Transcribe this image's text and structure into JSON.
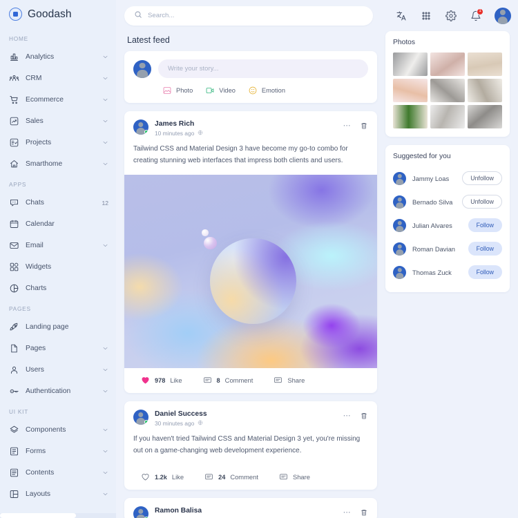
{
  "brand": {
    "name": "Goodash",
    "logo_icon": "goodash-logo"
  },
  "sidebar": {
    "groups": [
      {
        "label": "HOME",
        "items": [
          {
            "label": "Analytics",
            "icon": "bar-chart-icon",
            "chevron": true
          },
          {
            "label": "CRM",
            "icon": "people-group-icon",
            "chevron": true
          },
          {
            "label": "Ecommerce",
            "icon": "shopping-cart-icon",
            "chevron": true
          },
          {
            "label": "Sales",
            "icon": "trend-up-square-icon",
            "chevron": true
          },
          {
            "label": "Projects",
            "icon": "task-list-icon",
            "chevron": true
          },
          {
            "label": "Smarthome",
            "icon": "home-smart-icon",
            "chevron": true
          }
        ]
      },
      {
        "label": "APPS",
        "items": [
          {
            "label": "Chats",
            "icon": "chat-bubble-icon",
            "badge": "12"
          },
          {
            "label": "Calendar",
            "icon": "calendar-icon"
          },
          {
            "label": "Email",
            "icon": "envelope-icon",
            "chevron": true
          },
          {
            "label": "Widgets",
            "icon": "widgets-grid-icon"
          },
          {
            "label": "Charts",
            "icon": "pie-chart-icon"
          }
        ]
      },
      {
        "label": "PAGES",
        "items": [
          {
            "label": "Landing page",
            "icon": "rocket-icon"
          },
          {
            "label": "Pages",
            "icon": "document-icon",
            "chevron": true
          },
          {
            "label": "Users",
            "icon": "user-icon",
            "chevron": true
          },
          {
            "label": "Authentication",
            "icon": "key-icon",
            "chevron": true
          }
        ]
      },
      {
        "label": "UI KIT",
        "items": [
          {
            "label": "Components",
            "icon": "layers-diamond-icon",
            "chevron": true
          },
          {
            "label": "Forms",
            "icon": "form-list-icon",
            "chevron": true
          },
          {
            "label": "Contents",
            "icon": "content-lines-icon",
            "chevron": true
          },
          {
            "label": "Layouts",
            "icon": "layout-columns-icon",
            "chevron": true
          }
        ]
      }
    ]
  },
  "topbar": {
    "search_placeholder": "Search...",
    "search_value": "",
    "icons": [
      {
        "name": "translate-icon"
      },
      {
        "name": "apps-grid-icon"
      },
      {
        "name": "gear-icon"
      },
      {
        "name": "bell-icon",
        "badge": "1"
      }
    ],
    "avatar": "user-avatar"
  },
  "feed": {
    "title": "Latest feed",
    "composer": {
      "placeholder": "Write your story...",
      "value": "",
      "actions": [
        {
          "label": "Photo",
          "icon": "photo-icon",
          "color": "#e87fae"
        },
        {
          "label": "Video",
          "icon": "video-icon",
          "color": "#31b57c"
        },
        {
          "label": "Emotion",
          "icon": "emotion-icon",
          "color": "#e5b234"
        }
      ]
    },
    "posts": [
      {
        "author": "James Rich",
        "time": "10 minutes ago",
        "visibility_icon": "globe-icon",
        "text": "Tailwind CSS and Material Design 3 have become my go-to combo for creating stunning web interfaces that impress both clients and users.",
        "has_media": true,
        "media_alt": "abstract-gradient-sphere",
        "actions": [
          {
            "count": "978",
            "label": "Like",
            "icon": "heart-icon",
            "liked": true
          },
          {
            "count": "8",
            "label": "Comment",
            "icon": "comment-icon"
          },
          {
            "count": "",
            "label": "Share",
            "icon": "share-icon"
          }
        ]
      },
      {
        "author": "Daniel Success",
        "time": "30 minutes ago",
        "visibility_icon": "globe-icon",
        "text": "If you haven't tried Tailwind CSS and Material Design 3 yet, you're missing out on a game-changing web development experience.",
        "has_media": false,
        "actions": [
          {
            "count": "1.2k",
            "label": "Like",
            "icon": "heart-icon",
            "liked": false
          },
          {
            "count": "24",
            "label": "Comment",
            "icon": "comment-icon"
          },
          {
            "count": "",
            "label": "Share",
            "icon": "share-icon"
          }
        ]
      },
      {
        "author": "Ramon Balisa",
        "time": "",
        "visibility_icon": "globe-icon",
        "text": "",
        "has_media": false,
        "actions": []
      }
    ]
  },
  "right": {
    "photos": {
      "title": "Photos",
      "items": [
        {
          "alt": "white-candles-shadow",
          "c1": "#9a9b9d",
          "c2": "#efeeec"
        },
        {
          "alt": "pink-bottle-still-life",
          "c1": "#f3e4e1",
          "c2": "#cfb0a8"
        },
        {
          "alt": "beige-shelf-decor",
          "c1": "#eadfd2",
          "c2": "#d8c9b6"
        },
        {
          "alt": "pastel-candle-orange",
          "c1": "#f6e6e6",
          "c2": "#e8bfa6"
        },
        {
          "alt": "glass-jars-group",
          "c1": "#e9e7e4",
          "c2": "#9d9a96"
        },
        {
          "alt": "cosmetic-bottles-shelf",
          "c1": "#efece6",
          "c2": "#b3aca0"
        },
        {
          "alt": "green-leaf-plant",
          "c1": "#e9e3d6",
          "c2": "#3f7a2d"
        },
        {
          "alt": "minimal-vase-table",
          "c1": "#ececec",
          "c2": "#b8b5b0"
        },
        {
          "alt": "grey-wall-decor",
          "c1": "#d9d8d6",
          "c2": "#8e8c89"
        }
      ]
    },
    "suggested": {
      "title": "Suggested for you",
      "items": [
        {
          "name": "Jammy Loas",
          "action": "Unfollow",
          "state": "unfollow"
        },
        {
          "name": "Bernado Silva",
          "action": "Unfollow",
          "state": "unfollow"
        },
        {
          "name": "Julian Alvares",
          "action": "Follow",
          "state": "follow"
        },
        {
          "name": "Roman Davian",
          "action": "Follow",
          "state": "follow"
        },
        {
          "name": "Thomas Zuck",
          "action": "Follow",
          "state": "follow"
        }
      ]
    }
  },
  "colors": {
    "page_bg": "#eef2fb",
    "sidebar_bg": "#eaf0fa",
    "accent": "#2f5bb8",
    "like": "#f0328d",
    "badge_red": "#e8302a"
  }
}
